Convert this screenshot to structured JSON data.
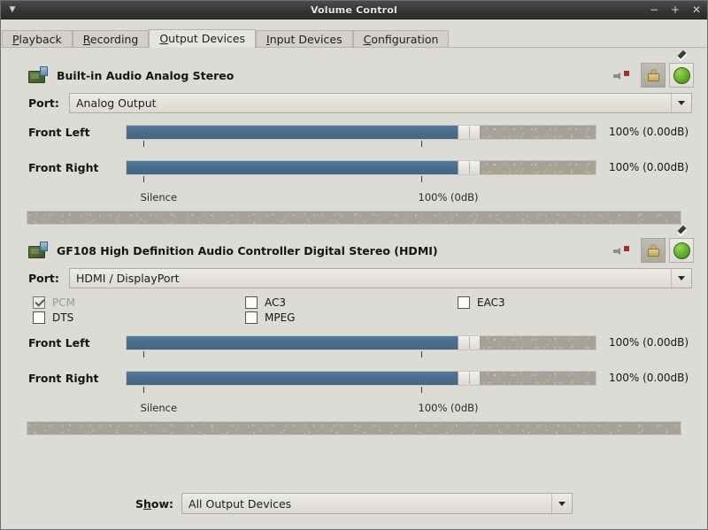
{
  "window": {
    "title": "Volume Control",
    "menu_icon": "chevron-down-icon",
    "buttons": {
      "minimize": "−",
      "maximize": "+",
      "close": "✕"
    }
  },
  "tabs": [
    {
      "label": "Playback",
      "mnemonic": "P",
      "selected": false
    },
    {
      "label": "Recording",
      "mnemonic": "R",
      "selected": false
    },
    {
      "label": "Output Devices",
      "mnemonic": "O",
      "selected": true
    },
    {
      "label": "Input Devices",
      "mnemonic": "I",
      "selected": false
    },
    {
      "label": "Configuration",
      "mnemonic": "C",
      "selected": false
    }
  ],
  "devices": [
    {
      "name": "Built-in Audio Analog Stereo",
      "icon": "audio-card-icon",
      "mute_icon": "speaker-muted-icon",
      "lock_icon": "lock-channels-icon",
      "default_icon": "default-device-check-icon",
      "port_label": "Port:",
      "port_value": "Analog Output",
      "has_codecs": false,
      "codecs": [],
      "channels": [
        {
          "label": "Front Left",
          "value": "100% (0.00dB)",
          "percent": 73.0
        },
        {
          "label": "Front Right",
          "value": "100% (0.00dB)",
          "percent": 73.0
        }
      ],
      "ticks": [
        {
          "label": "Silence",
          "percent": 3.5
        },
        {
          "label": "100% (0dB)",
          "percent": 62.5
        }
      ]
    },
    {
      "name": "GF108 High Definition Audio Controller Digital Stereo (HDMI)",
      "icon": "audio-card-icon",
      "mute_icon": "speaker-muted-icon",
      "lock_icon": "lock-channels-icon",
      "default_icon": "default-device-check-icon",
      "port_label": "Port:",
      "port_value": "HDMI / DisplayPort",
      "has_codecs": true,
      "codecs": [
        {
          "label": "PCM",
          "checked": true,
          "disabled": true
        },
        {
          "label": "AC3",
          "checked": false,
          "disabled": false
        },
        {
          "label": "EAC3",
          "checked": false,
          "disabled": false
        },
        {
          "label": "DTS",
          "checked": false,
          "disabled": false
        },
        {
          "label": "MPEG",
          "checked": false,
          "disabled": false
        },
        {
          "label": "",
          "checked": false,
          "disabled": false
        }
      ],
      "channels": [
        {
          "label": "Front Left",
          "value": "100% (0.00dB)",
          "percent": 73.0
        },
        {
          "label": "Front Right",
          "value": "100% (0.00dB)",
          "percent": 73.0
        }
      ],
      "ticks": [
        {
          "label": "Silence",
          "percent": 3.5
        },
        {
          "label": "100% (0dB)",
          "percent": 62.5
        }
      ]
    }
  ],
  "footer": {
    "show_label": "Show:",
    "show_mnemonic": "h",
    "show_value": "All Output Devices"
  },
  "colors": {
    "accent_fill": "#4a6d8c",
    "trough": "#a5a296",
    "window_bg": "#dcdbd6",
    "default_green": "#63ad2b",
    "mute_red": "#a33024"
  }
}
